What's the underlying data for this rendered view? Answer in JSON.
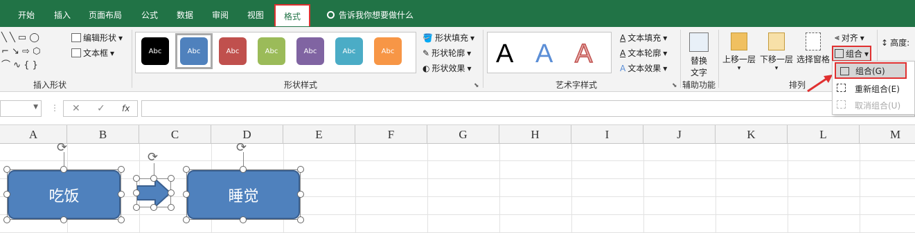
{
  "tabs": {
    "home": "开始",
    "insert": "插入",
    "layout": "页面布局",
    "formulas": "公式",
    "data": "数据",
    "review": "审阅",
    "view": "视图",
    "format": "格式"
  },
  "tell_me": "告诉我你想要做什么",
  "insert_shapes": {
    "edit_shape": "编辑形状",
    "text_box": "文本框",
    "label": "插入形状"
  },
  "shape_styles": {
    "styles": [
      {
        "text": "Abc",
        "color": "#000000"
      },
      {
        "text": "Abc",
        "color": "#4f81bd"
      },
      {
        "text": "Abc",
        "color": "#c0504d"
      },
      {
        "text": "Abc",
        "color": "#9bbb59"
      },
      {
        "text": "Abc",
        "color": "#8064a2"
      },
      {
        "text": "Abc",
        "color": "#4bacc6"
      },
      {
        "text": "Abc",
        "color": "#f79646"
      }
    ],
    "fill": "形状填充",
    "outline": "形状轮廓",
    "effects": "形状效果",
    "label": "形状样式"
  },
  "wordart": {
    "letters": [
      "A",
      "A",
      "A"
    ],
    "text_fill": "文本填充",
    "text_outline": "文本轮廓",
    "text_effects": "文本效果",
    "label": "艺术字样式"
  },
  "accessibility": {
    "alt_text_1": "替换",
    "alt_text_2": "文字",
    "label": "辅助功能"
  },
  "arrange": {
    "bring_forward": "上移一层",
    "send_backward": "下移一层",
    "selection_pane": "选择窗格",
    "align": "对齐",
    "group": "组合",
    "label": "排列"
  },
  "size": {
    "height": "高度:"
  },
  "formula_bar": {
    "cancel": "✕",
    "enter": "✓",
    "fx": "fx",
    "sep": "⋮"
  },
  "columns": [
    "A",
    "B",
    "C",
    "D",
    "E",
    "F",
    "G",
    "H",
    "I",
    "J",
    "K",
    "L",
    "M"
  ],
  "shapes": {
    "left": "吃饭",
    "right": "睡觉"
  },
  "group_menu": [
    {
      "label": "组合(G)",
      "enabled": true
    },
    {
      "label": "重新组合(E)",
      "enabled": true
    },
    {
      "label": "取消组合(U)",
      "enabled": false
    }
  ]
}
